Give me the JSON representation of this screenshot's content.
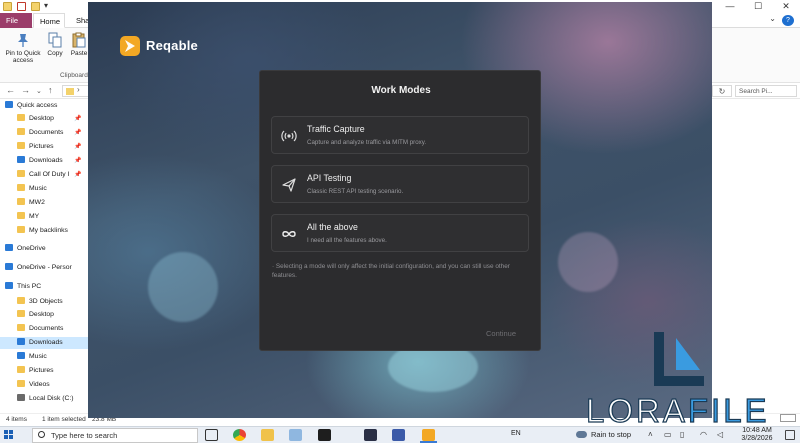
{
  "explorer": {
    "tabs": [
      "File",
      "Home",
      "Shar"
    ],
    "ribbon": {
      "pin_label": "Pin to Quick access",
      "copy_label": "Copy",
      "paste_label": "Paste",
      "group_label": "Clipboard"
    },
    "search_placeholder": "Search Pi...",
    "nav_items": [
      {
        "label": "Quick access",
        "icon": "star-icon"
      },
      {
        "label": "Desktop",
        "icon": "folder-icon"
      },
      {
        "label": "Documents",
        "icon": "folder-icon"
      },
      {
        "label": "Pictures",
        "icon": "folder-icon"
      },
      {
        "label": "Downloads",
        "icon": "download-icon"
      },
      {
        "label": "Call Of Duty I",
        "icon": "folder-icon"
      },
      {
        "label": "Music",
        "icon": "folder-icon"
      },
      {
        "label": "MW2",
        "icon": "folder-icon"
      },
      {
        "label": "MY",
        "icon": "folder-icon"
      },
      {
        "label": "My backlinks",
        "icon": "folder-icon"
      },
      {
        "label": "OneDrive",
        "icon": "cloud-icon"
      },
      {
        "label": "OneDrive - Persor",
        "icon": "cloud-icon"
      },
      {
        "label": "This PC",
        "icon": "computer-icon"
      },
      {
        "label": "3D Objects",
        "icon": "folder-icon"
      },
      {
        "label": "Desktop",
        "icon": "folder-icon"
      },
      {
        "label": "Documents",
        "icon": "folder-icon"
      },
      {
        "label": "Downloads",
        "icon": "download-icon"
      },
      {
        "label": "Music",
        "icon": "music-icon"
      },
      {
        "label": "Pictures",
        "icon": "folder-icon"
      },
      {
        "label": "Videos",
        "icon": "folder-icon"
      },
      {
        "label": "Local Disk (C:)",
        "icon": "drive-icon"
      }
    ],
    "status": {
      "item_count": "4 items",
      "selection": "1 item selected",
      "size": "23.8 MB"
    }
  },
  "reqable": {
    "app_name": "Reqable",
    "dialog_title": "Work Modes",
    "modes": [
      {
        "title": "Traffic Capture",
        "description": "Capture and analyze traffic via MITM proxy.",
        "icon": "broadcast-icon"
      },
      {
        "title": "API Testing",
        "description": "Classic REST API testing scenario.",
        "icon": "paper-plane-icon"
      },
      {
        "title": "All the above",
        "description": "I need all the features above.",
        "icon": "infinity-icon"
      }
    ],
    "note": "· Selecting a mode will only affect the initial configuration, and you can still use other features.",
    "continue_label": "Continue"
  },
  "watermark": {
    "part1": "LORA",
    "part2": "FILE"
  },
  "taskbar": {
    "search_placeholder": "Type here to search",
    "language": "EN",
    "weather": "Rain to stop",
    "time": "10:48 AM",
    "date": "3/28/2026"
  },
  "colors": {
    "file_tab": "#9b3d6a",
    "reqable_logo": "#f3a824",
    "dialog_bg": "#2c2c2e",
    "watermark_blue": "#3a9be0",
    "watermark_dark": "#1a3a55"
  }
}
